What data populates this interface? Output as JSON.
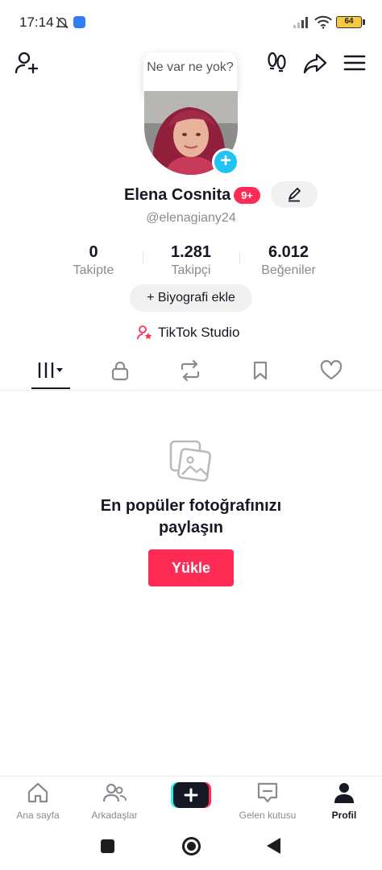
{
  "status_bar": {
    "time": "17:14",
    "battery": "64"
  },
  "header": {
    "tooltip": "Ne var ne yok?",
    "icons": [
      "add-friend-icon",
      "footprints-icon",
      "share-icon",
      "menu-icon"
    ]
  },
  "profile": {
    "name": "Elena Cosnita",
    "badge": "9+",
    "handle": "@elenagiany24"
  },
  "stats": [
    {
      "value": "0",
      "label": "Takipte"
    },
    {
      "value": "1.281",
      "label": "Takipçi"
    },
    {
      "value": "6.012",
      "label": "Beğeniler"
    }
  ],
  "bio_button": "+ Biyografi ekle",
  "studio_link": "TikTok Studio",
  "tabs": [
    "videos-grid-icon",
    "lock-icon",
    "repost-icon",
    "bookmark-icon",
    "heart-icon"
  ],
  "empty_state": {
    "title": "En popüler fotoğrafınızı paylaşın",
    "button": "Yükle"
  },
  "bottom_nav": [
    {
      "label": "Ana sayfa",
      "icon": "home-icon"
    },
    {
      "label": "Arkadaşlar",
      "icon": "friends-icon"
    },
    {
      "label": "",
      "icon": "plus-icon"
    },
    {
      "label": "Gelen kutusu",
      "icon": "inbox-icon"
    },
    {
      "label": "Profil",
      "icon": "profile-icon"
    }
  ],
  "colors": {
    "accent": "#fe2c55",
    "avatar_plus": "#20c3f1",
    "text": "#161823",
    "muted": "#8a8b91"
  }
}
